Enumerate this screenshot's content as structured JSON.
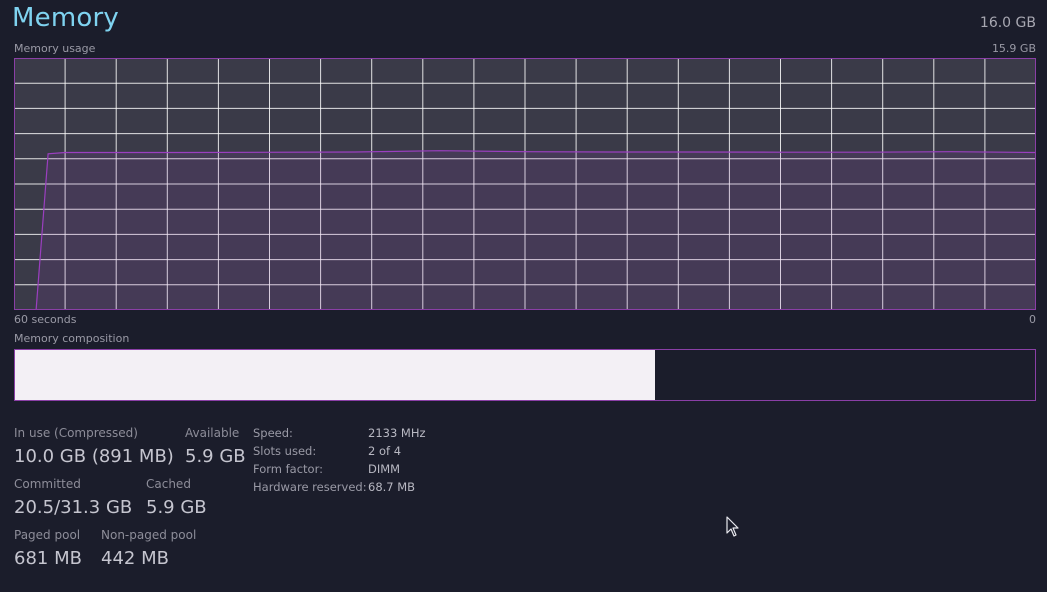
{
  "header": {
    "title": "Memory",
    "total": "16.0 GB"
  },
  "graph": {
    "label": "Memory usage",
    "max_label": "15.9 GB",
    "left_time": "60 seconds",
    "right_time": "0",
    "grid_color": "#ffffff",
    "line_color": "#9b3fc0",
    "bg_color": "#3a3a48"
  },
  "chart_data": {
    "type": "area",
    "x": [
      60,
      58.7,
      58,
      57,
      50,
      40,
      35,
      30,
      25,
      20,
      15,
      10,
      5,
      0
    ],
    "values": [
      0,
      0,
      6.2,
      6.25,
      6.25,
      6.27,
      6.32,
      6.28,
      6.27,
      6.27,
      6.26,
      6.26,
      6.28,
      6.25
    ],
    "xlabel": "",
    "ylabel": "",
    "xlim": [
      60,
      0
    ],
    "ylim": [
      0,
      10
    ],
    "grid": true
  },
  "composition": {
    "label": "Memory composition",
    "in_use_fraction": 0.627
  },
  "stats": {
    "in_use_label": "In use (Compressed)",
    "in_use_value": "10.0 GB (891 MB)",
    "available_label": "Available",
    "available_value": "5.9 GB",
    "committed_label": "Committed",
    "committed_value": "20.5/31.3 GB",
    "cached_label": "Cached",
    "cached_value": "5.9 GB",
    "paged_label": "Paged pool",
    "paged_value": "681 MB",
    "nonpaged_label": "Non-paged pool",
    "nonpaged_value": "442 MB"
  },
  "specs": [
    {
      "label": "Speed:",
      "value": "2133 MHz"
    },
    {
      "label": "Slots used:",
      "value": "2 of 4"
    },
    {
      "label": "Form factor:",
      "value": "DIMM"
    },
    {
      "label": "Hardware reserved:",
      "value": "68.7 MB"
    }
  ],
  "icons": {
    "cursor": "mouse-pointer-icon"
  }
}
